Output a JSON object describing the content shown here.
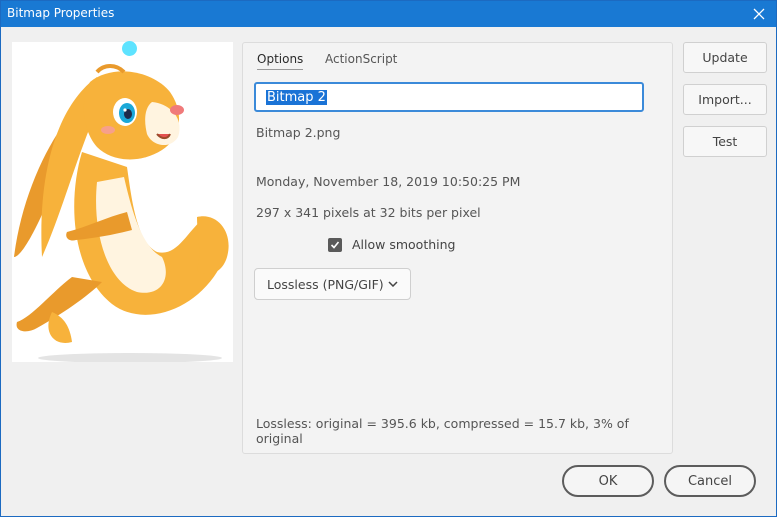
{
  "window": {
    "title": "Bitmap Properties"
  },
  "tabs": [
    "Options",
    "ActionScript"
  ],
  "bitmap": {
    "name_value": "Bitmap 2",
    "filename": "Bitmap 2.png",
    "date": "Monday, November 18, 2019  10:50:25 PM",
    "dimensions": "297 x 341 pixels at 32 bits per pixel",
    "allow_smoothing_label": "Allow smoothing",
    "allow_smoothing_checked": true,
    "compression": "Lossless (PNG/GIF)",
    "compression_info": "Lossless: original = 395.6 kb, compressed = 15.7 kb, 3% of original"
  },
  "side_buttons": {
    "update": "Update",
    "import": "Import...",
    "test": "Test"
  },
  "footer": {
    "ok": "OK",
    "cancel": "Cancel"
  },
  "colors": {
    "titlebar": "#1979d3",
    "accent": "#1a73d6",
    "rabbit_orange": "#f7b23b",
    "registration_point": "#5ee3ff"
  },
  "icons": {
    "close": "close-icon",
    "checkmark": "checkmark-icon",
    "chevron": "chevron-down-icon"
  }
}
